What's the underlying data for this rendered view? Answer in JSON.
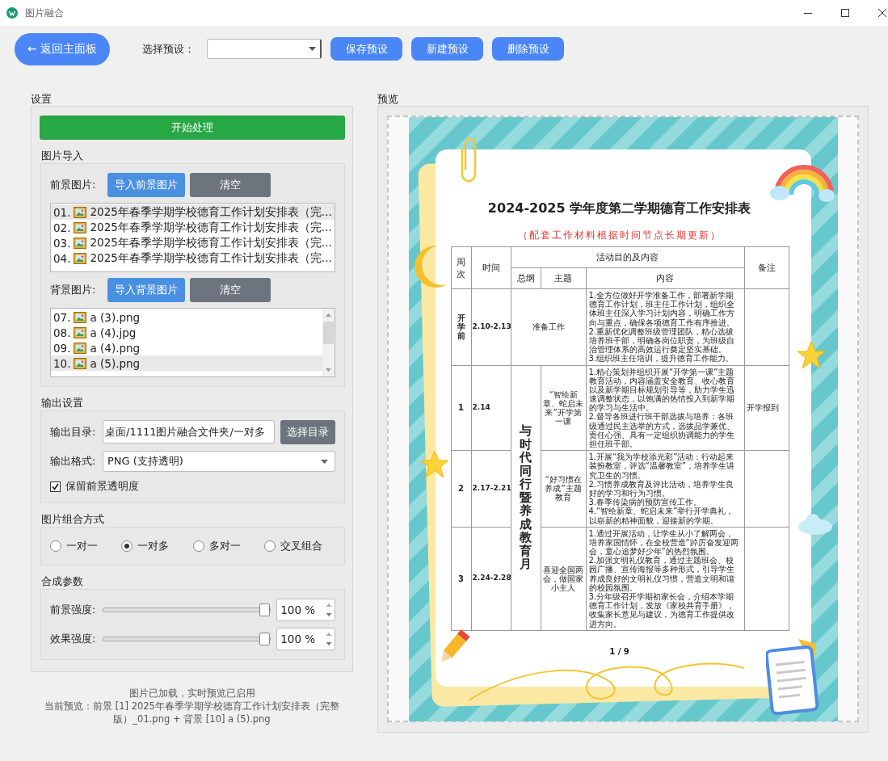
{
  "window": {
    "title": "图片融合"
  },
  "toolbar": {
    "back_button": "← 返回主面板",
    "preset_label": "选择预设：",
    "buttons": [
      "保存预设",
      "新建预设",
      "删除预设"
    ]
  },
  "settings": {
    "title": "设置",
    "start_button": "开始处理",
    "import": {
      "title": "图片导入",
      "foreground": {
        "label": "前景图片:",
        "import_button": "导入前景图片",
        "clear_button": "清空",
        "items": [
          {
            "index": "01.",
            "name": "2025年春季学期学校德育工作计划安排表（完...",
            "selected": true
          },
          {
            "index": "02.",
            "name": "2025年春季学期学校德育工作计划安排表（完...",
            "selected": false
          },
          {
            "index": "03.",
            "name": "2025年春季学期学校德育工作计划安排表（完...",
            "selected": false
          },
          {
            "index": "04.",
            "name": "2025年春季学期学校德育工作计划安排表（完...",
            "selected": false
          }
        ]
      },
      "background": {
        "label": "背景图片:",
        "import_button": "导入背景图片",
        "clear_button": "清空",
        "items": [
          {
            "index": "07.",
            "name": "a (3).png",
            "selected": false
          },
          {
            "index": "08.",
            "name": "a (4).jpg",
            "selected": false
          },
          {
            "index": "09.",
            "name": "a (4).png",
            "selected": false
          },
          {
            "index": "10.",
            "name": "a (5).png",
            "selected": true
          }
        ]
      }
    },
    "output": {
      "title": "输出设置",
      "dir_label": "输出目录:",
      "dir_value": "桌面/1111图片融合文件夹/一对多",
      "dir_button": "选择目录",
      "format_label": "输出格式:",
      "format_value": "PNG (支持透明)",
      "keep_alpha": {
        "label": "保留前景透明度",
        "checked": true
      }
    },
    "combine": {
      "title": "图片组合方式",
      "options": [
        {
          "label": "一对一",
          "selected": false
        },
        {
          "label": "一对多",
          "selected": true
        },
        {
          "label": "多对一",
          "selected": false
        },
        {
          "label": "交叉组合",
          "selected": false
        }
      ]
    },
    "params": {
      "title": "合成参数",
      "sliders": [
        {
          "label": "前景强度:",
          "level": 1,
          "value": "100 %"
        },
        {
          "label": "效果强度:",
          "level": 1,
          "value": "100 %"
        }
      ]
    }
  },
  "status": [
    "图片已加载，实时预览已启用",
    "当前预览：前景 [1] 2025年春季学期学校德育工作计划安排表（完整版）_01.png + 背景 [10] a (5).png"
  ],
  "preview": {
    "title": "预览",
    "document": {
      "title": "2024-2025 学年度第二学期德育工作安排表",
      "subtitle": "（配套工作材料根据时间节点长期更新）",
      "headers": {
        "week": "周次",
        "time": "时间",
        "activity": "活动目的及内容",
        "outline": "总纲",
        "theme": "主题",
        "content": "内容",
        "note": "备注"
      },
      "outline": "与时代同行暨养成教育月",
      "rows": [
        {
          "kind": "prep",
          "week": "开学前",
          "time": "2.10-2.13",
          "outline": "准备工作",
          "content": "1.全方位做好开学准备工作，部署新学期德育工作计划，班主任工作计划，组织全体班主任深入学习计划内容，明确工作方向与重点，确保各项德育工作有序推进。\n2.重新优化调整班级管理团队，精心选拔培养班干部，明确各岗位职责，为班级自治管理体系的高效运行奠定坚实基础。\n3.组织班主任培训，提升德育工作能力。"
        },
        {
          "kind": "standard",
          "week": "1",
          "time": "2.14",
          "theme": "“智绘新章、蛇启未来”开学第一课",
          "content": "1.精心策划并组织开展“开学第一课”主题教育活动，内容涵盖安全教育、收心教育以及新学期目标规划引导等，助力学生迅速调整状态，以饱满的热情投入到新学期的学习与生活中。\n2.督导各班进行班干部选拔与培养：各班级通过民主选举的方式，选拔品学兼优、责任心强、具有一定组织协调能力的学生担任班干部。",
          "note": "开学报到"
        },
        {
          "kind": "standard",
          "week": "2",
          "time": "2.17-2.21",
          "theme": "“好习惯在养成”主题教育",
          "content": "1.开展“我为学校添光彩”活动：行动起来装扮教室，评选“温馨教室”，培养学生讲究卫生的习惯。\n2.习惯养成教育及评比活动，培养学生良好的学习和行为习惯。\n3.春季传染病的预防宣传工作。\n4.“智绘新章、蛇启未来”举行开学典礼，以崭新的精神面貌，迎接新的学期。"
        },
        {
          "kind": "standard",
          "week": "3",
          "time": "2.24-2.28",
          "theme": "喜迎全国两会，做国家小主人",
          "content": "1.通过开展活动，让学生从小了解两会，培养家国情怀，在全校营造“踔厉奋发迎两会，童心追梦好少年”的热烈氛围。\n2.加强文明礼仪教育，通过主题班会、校园广播、宣传海报等多种形式，引导学生养成良好的文明礼仪习惯，营造文明和谐的校园氛围。\n3.分年级召开学期初家长会，介绍本学期德育工作计划，发放《家校共育手册》，收集家长意见与建议，为德育工作提供改进方向。"
        }
      ],
      "page": "1 / 9"
    }
  }
}
